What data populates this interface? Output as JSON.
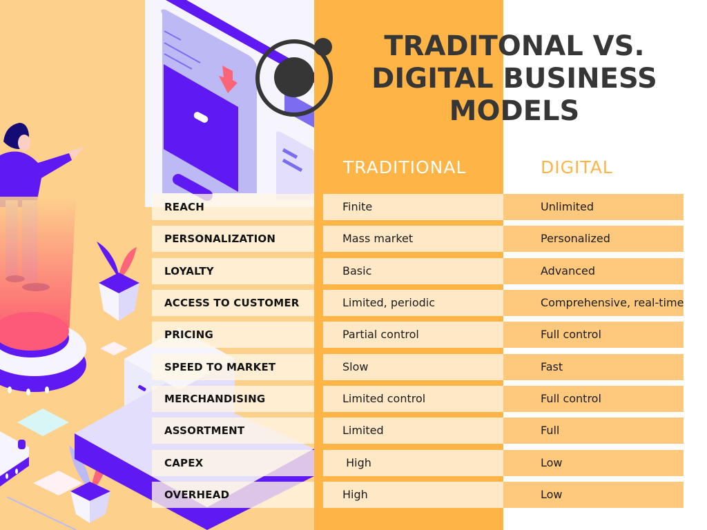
{
  "title": {
    "line1": "TRADITONAL VS.",
    "line2": "DIGITAL BUSINESS",
    "line3": "MODELS"
  },
  "columns": {
    "traditional": "TRADITIONAL",
    "digital": "DIGITAL"
  },
  "rows": [
    {
      "label": "REACH",
      "traditional": "Finite",
      "digital": "Unlimited"
    },
    {
      "label": "PERSONALIZATION",
      "traditional": "Mass market",
      "digital": "Personalized"
    },
    {
      "label": "LOYALTY",
      "traditional": "Basic",
      "digital": "Advanced"
    },
    {
      "label": "ACCESS TO CUSTOMER",
      "traditional": "Limited, periodic",
      "digital": "Comprehensive, real-time"
    },
    {
      "label": "PRICING",
      "traditional": "Partial control",
      "digital": "Full control"
    },
    {
      "label": "SPEED TO MARKET",
      "traditional": "Slow",
      "digital": "Fast"
    },
    {
      "label": "MERCHANDISING",
      "traditional": "Limited control",
      "digital": "Full control"
    },
    {
      "label": "ASSORTMENT",
      "traditional": "Limited",
      "digital": "Full"
    },
    {
      "label": "CAPEX",
      "traditional": " High",
      "digital": "Low"
    },
    {
      "label": "OVERHEAD",
      "traditional": "High",
      "digital": "Low"
    }
  ],
  "colors": {
    "left_bg": "#fdd08c",
    "traditional_column": "#ffb446",
    "traditional_cell": "#ffe8c6",
    "digital_cell": "#fec97c",
    "title_text": "#363636",
    "digital_header": "#ffb446",
    "illustration_purple": "#5f19f2",
    "illustration_lavender": "#bdb9f5",
    "illustration_pink": "#fc6478"
  },
  "icons": {
    "logo": "orbit-logo-icon",
    "illustration": "isometric-ecommerce-illustration"
  }
}
